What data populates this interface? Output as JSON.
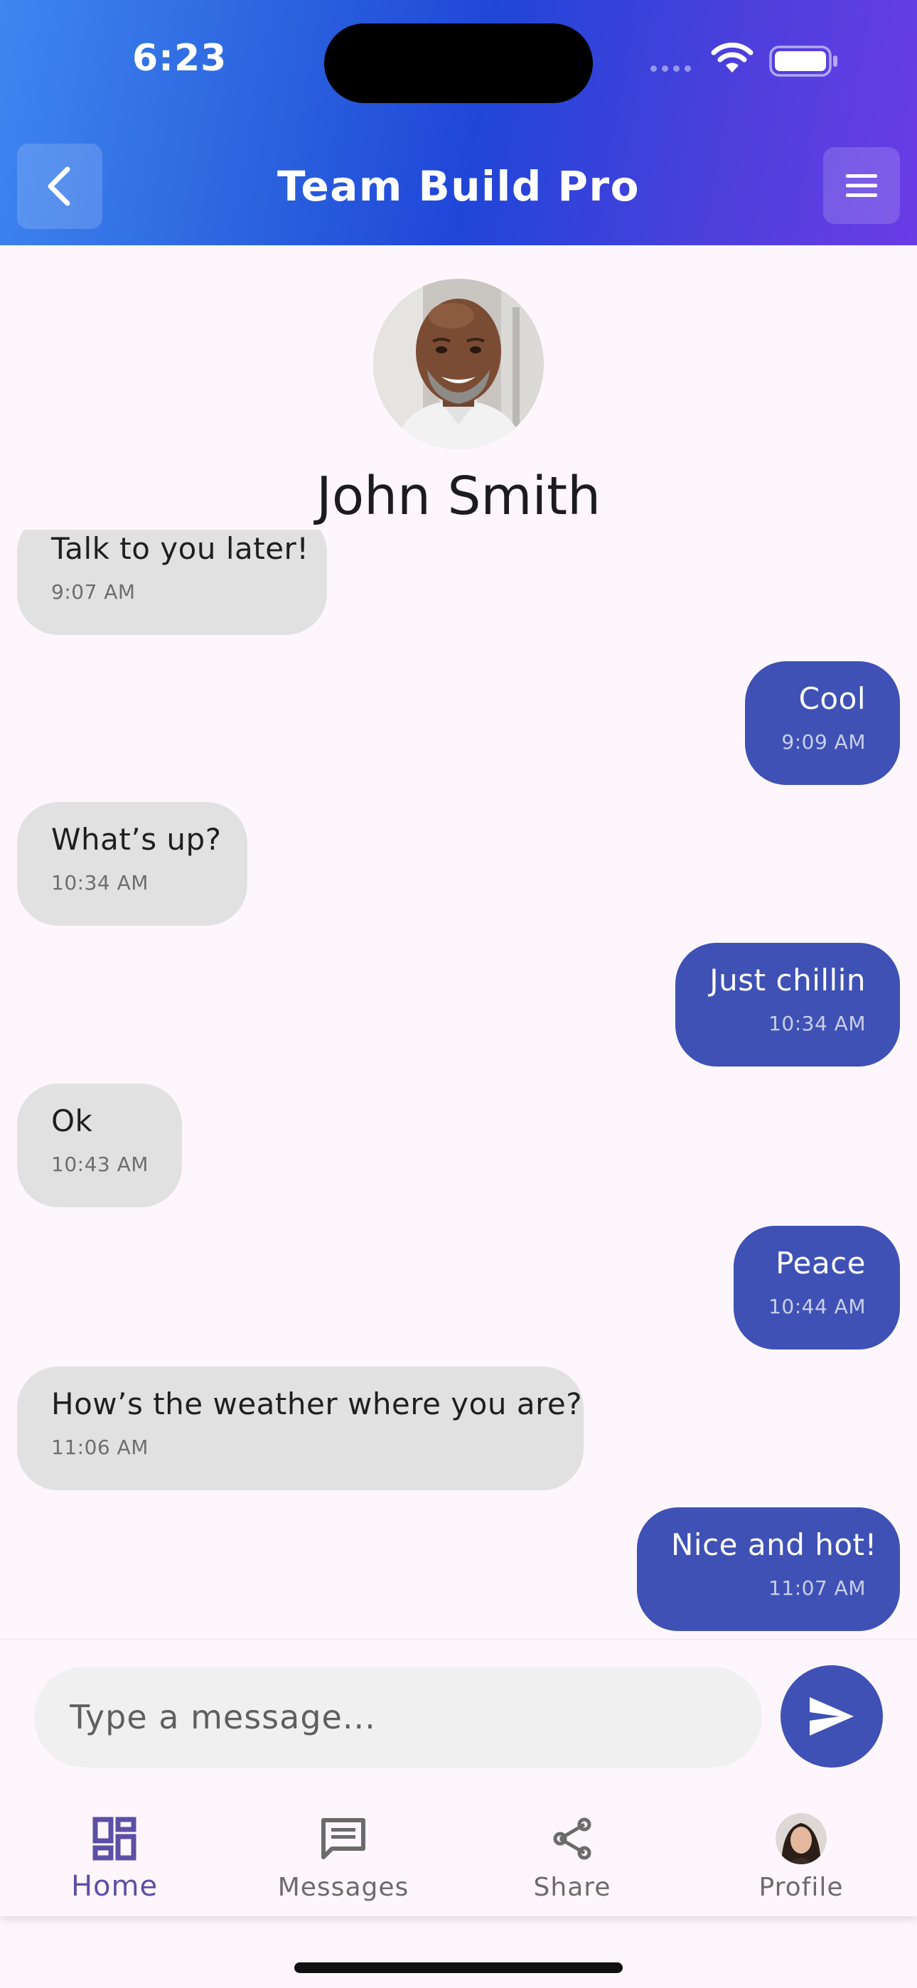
{
  "status_bar": {
    "time": "6:23"
  },
  "header": {
    "title": "Team Build Pro"
  },
  "contact": {
    "name": "John Smith"
  },
  "messages": [
    {
      "direction": "in",
      "text": "Talk to you later!",
      "time": "9:07 AM"
    },
    {
      "direction": "out",
      "text": "Cool",
      "time": "9:09 AM"
    },
    {
      "direction": "in",
      "text": "What’s up?",
      "time": "10:34 AM"
    },
    {
      "direction": "out",
      "text": "Just chillin",
      "time": "10:34 AM"
    },
    {
      "direction": "in",
      "text": "Ok",
      "time": "10:43 AM"
    },
    {
      "direction": "out",
      "text": "Peace",
      "time": "10:44 AM"
    },
    {
      "direction": "in",
      "text": "How’s the weather where you are?",
      "time": "11:06 AM"
    },
    {
      "direction": "out",
      "text": "Nice and hot!",
      "time": "11:07 AM"
    }
  ],
  "composer": {
    "placeholder": "Type a message..."
  },
  "nav": [
    {
      "label": "Home",
      "icon": "dashboard-icon",
      "active": true
    },
    {
      "label": "Messages",
      "icon": "chat-icon",
      "active": false
    },
    {
      "label": "Share",
      "icon": "share-icon",
      "active": false
    },
    {
      "label": "Profile",
      "icon": "avatar",
      "active": false
    }
  ],
  "colors": {
    "header_gradient_start": "#3f86f0",
    "header_gradient_end": "#6a3ce6",
    "outgoing_bubble": "#3f51b5",
    "incoming_bubble": "#e1e1e1",
    "nav_active": "#5c4fa6"
  }
}
